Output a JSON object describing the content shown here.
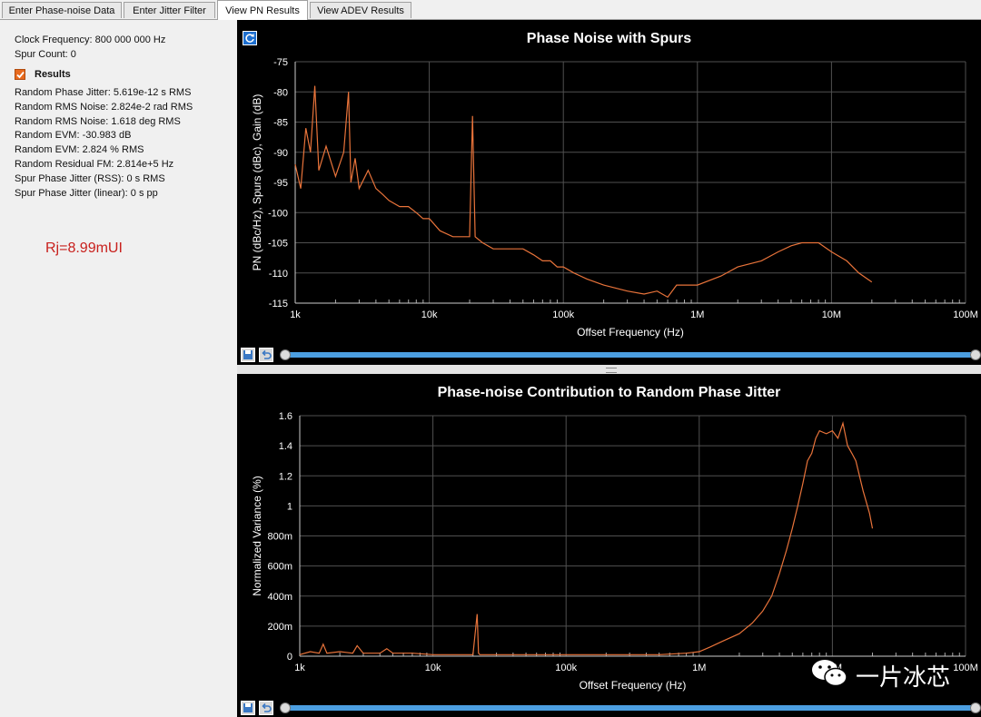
{
  "tabs": [
    {
      "label": "Enter Phase-noise Data"
    },
    {
      "label": "Enter Jitter Filter"
    },
    {
      "label": "View PN Results"
    },
    {
      "label": "View ADEV Results"
    }
  ],
  "info": {
    "clock_frequency": "Clock Frequency:  800 000 000 Hz",
    "spur_count": "Spur Count:  0",
    "results_label": "Results",
    "results_checked": true,
    "results": [
      "Random Phase Jitter:  5.619e-12 s RMS",
      "Random RMS Noise:  2.824e-2 rad RMS",
      "Random RMS Noise:  1.618 deg RMS",
      "Random EVM:  -30.983 dB",
      "Random EVM:  2.824 % RMS",
      "Random Residual FM:  2.814e+5 Hz",
      "Spur Phase Jitter (RSS):  0 s RMS",
      "Spur Phase Jitter (linear):  0 s pp"
    ]
  },
  "annotation": "Rj=8.99mUI",
  "watermark": "一片冰芯",
  "colors": {
    "trace": "#e8733a",
    "grid": "#505050",
    "panel_bg": "#000000",
    "annotation": "#c8201d"
  },
  "chart_data": [
    {
      "type": "line",
      "title": "Phase Noise with Spurs",
      "xlabel": "Offset Frequency (Hz)",
      "ylabel": "PN (dBc/Hz), Spurs (dBc), Gain (dB)",
      "xscale": "log",
      "xlim": [
        1000,
        100000000
      ],
      "ylim": [
        -115,
        -75
      ],
      "x_tick_labels": [
        "1k",
        "10k",
        "100k",
        "1M",
        "10M",
        "100M"
      ],
      "y_ticks": [
        -75,
        -80,
        -85,
        -90,
        -95,
        -100,
        -105,
        -110,
        -115
      ],
      "grid": true,
      "series": [
        {
          "x": [
            1000,
            1100,
            1200,
            1300,
            1400,
            1500,
            1700,
            2000,
            2300,
            2500,
            2600,
            2800,
            3000,
            3500,
            4000,
            4500,
            5000,
            6000,
            7000,
            8000,
            9000,
            10000,
            12000,
            15000,
            18000,
            20000,
            21000,
            22000,
            25000,
            30000,
            40000,
            50000,
            60000,
            70000,
            80000,
            90000,
            100000,
            120000,
            150000,
            200000,
            300000,
            400000,
            500000,
            600000,
            700000,
            800000,
            1000000,
            1500000,
            2000000,
            3000000,
            4000000,
            5000000,
            6000000,
            7000000,
            8000000,
            10000000,
            13000000,
            16000000,
            20000000
          ],
          "values": [
            -92,
            -96,
            -86,
            -90,
            -79,
            -93,
            -89,
            -94,
            -90,
            -80,
            -95,
            -91,
            -96,
            -93,
            -96,
            -97,
            -98,
            -99,
            -99,
            -100,
            -101,
            -101,
            -103,
            -104,
            -104,
            -104,
            -84,
            -104,
            -105,
            -106,
            -106,
            -106,
            -107,
            -108,
            -108,
            -109,
            -109,
            -110,
            -111,
            -112,
            -113,
            -113.5,
            -113,
            -114,
            -112,
            -112,
            -112,
            -110.5,
            -109,
            -108,
            -106.5,
            -105.5,
            -105,
            -105,
            -105,
            -106.5,
            -108,
            -110,
            -111.5
          ]
        }
      ]
    },
    {
      "type": "line",
      "title": "Phase-noise Contribution to Random Phase Jitter",
      "xlabel": "Offset Frequency (Hz)",
      "ylabel": "Normalized Variance (%)",
      "xscale": "log",
      "xlim": [
        1000,
        100000000
      ],
      "ylim": [
        0,
        1.6
      ],
      "x_tick_labels": [
        "1k",
        "10k",
        "100k",
        "1M",
        "10M",
        "100M"
      ],
      "y_ticks": [
        0,
        0.2,
        0.4,
        0.6,
        0.8,
        1,
        1.2,
        1.4,
        1.6
      ],
      "y_tick_labels": [
        "0",
        "200m",
        "400m",
        "600m",
        "800m",
        "1",
        "1.2",
        "1.4",
        "1.6"
      ],
      "grid": true,
      "series": [
        {
          "x": [
            1000,
            1200,
            1400,
            1500,
            1600,
            2000,
            2500,
            2700,
            3000,
            4000,
            4500,
            5000,
            7000,
            10000,
            15000,
            20000,
            21500,
            22000,
            22500,
            25000,
            30000,
            50000,
            100000,
            200000,
            500000,
            800000,
            1000000,
            1200000,
            1500000,
            2000000,
            2500000,
            3000000,
            3500000,
            4000000,
            4500000,
            5000000,
            5500000,
            6000000,
            6500000,
            7000000,
            7500000,
            8000000,
            9000000,
            10000000,
            11000000,
            12000000,
            13000000,
            14000000,
            15000000,
            17000000,
            19000000,
            20000000
          ],
          "values": [
            0.01,
            0.03,
            0.02,
            0.08,
            0.02,
            0.03,
            0.02,
            0.07,
            0.02,
            0.02,
            0.05,
            0.02,
            0.02,
            0.01,
            0.01,
            0.01,
            0.28,
            0.02,
            0.01,
            0.01,
            0.01,
            0.01,
            0.01,
            0.01,
            0.01,
            0.02,
            0.03,
            0.06,
            0.1,
            0.15,
            0.22,
            0.3,
            0.4,
            0.55,
            0.7,
            0.85,
            1.0,
            1.15,
            1.3,
            1.35,
            1.45,
            1.5,
            1.48,
            1.5,
            1.45,
            1.55,
            1.4,
            1.35,
            1.3,
            1.1,
            0.95,
            0.85
          ]
        }
      ]
    }
  ]
}
